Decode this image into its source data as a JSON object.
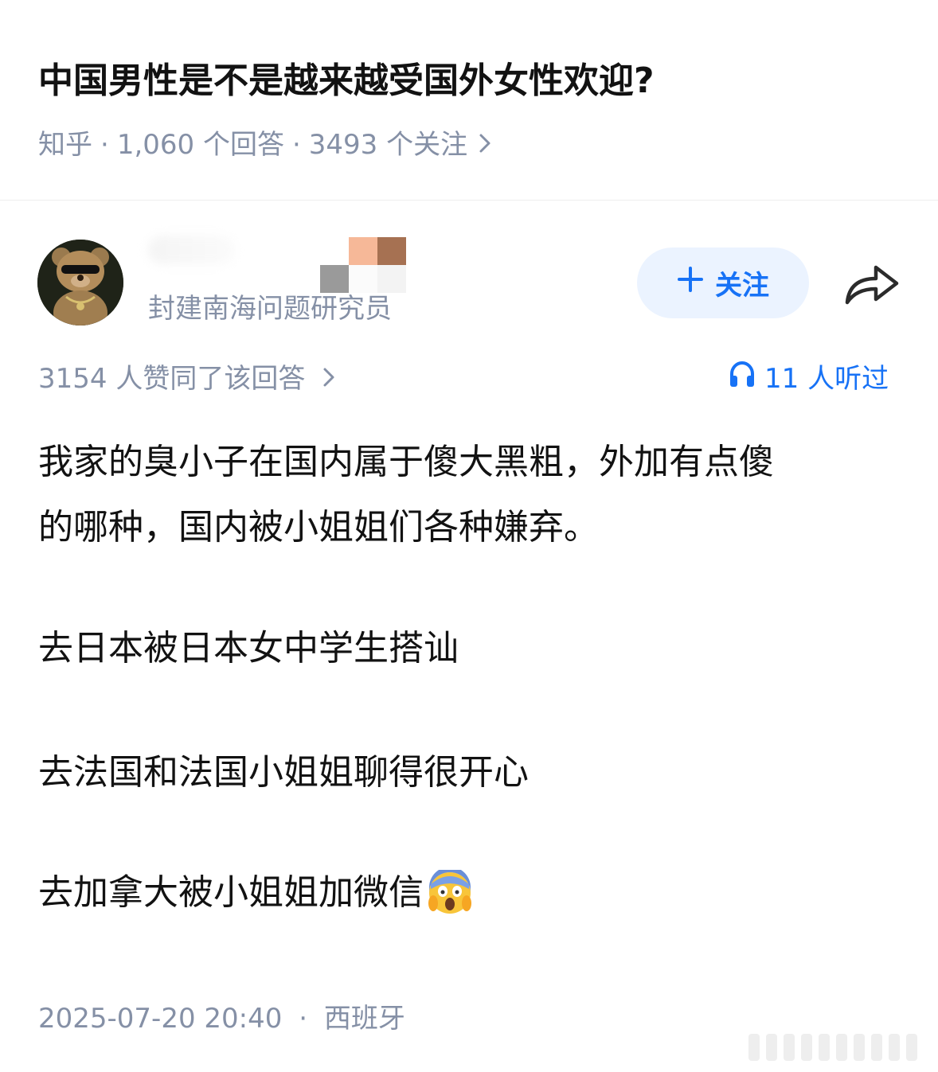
{
  "question": {
    "title": "中国男性是不是越来越受国外女性欢迎?",
    "source": "知乎",
    "separator": "·",
    "answers": "1,060 个回答",
    "followers": "3493 个关注"
  },
  "author": {
    "bio": "封建南海问题研究员",
    "avatar_icon": "teddy-bear-avatar",
    "follow_label": "关注",
    "follow_icon": "plus-icon",
    "share_icon": "share-arrow-icon"
  },
  "stats": {
    "votes": "3154 人赞同了该回答",
    "listeners": "11 人听过",
    "listen_icon": "headphones-icon"
  },
  "answer": {
    "line1": "我家的臭小子在国内属于傻大黑粗，外加有点傻",
    "line2": "的哪种，国内被小姐姐们各种嫌弃。",
    "para2": "去日本被日本女中学生搭讪",
    "para3": "去法国和法国小姐姐聊得很开心",
    "para4": "去加拿大被小姐姐加微信",
    "emoji": "screaming-face-emoji"
  },
  "footer": {
    "timestamp": "2025-07-20 20:40",
    "separator": "·",
    "location": "西班牙"
  },
  "colors": {
    "accent": "#1772f6",
    "meta": "#8590a6",
    "text": "#121212",
    "follow_bg": "#ebf3ff"
  }
}
